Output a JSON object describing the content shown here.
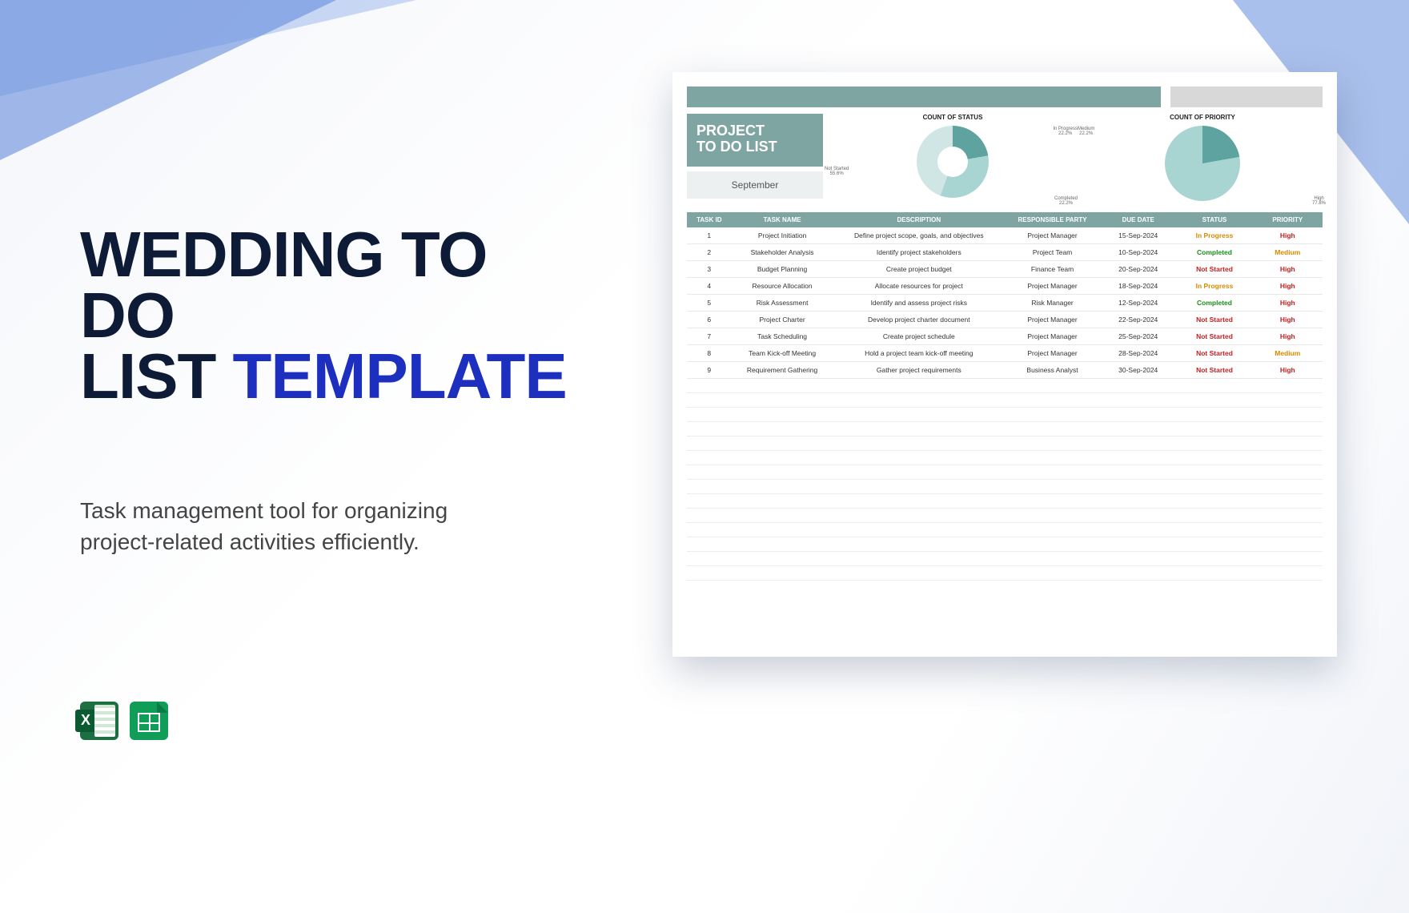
{
  "title": {
    "line1": "WEDDING TO DO",
    "line2a": "LIST ",
    "line2b": "TEMPLATE"
  },
  "subtitle": "Task management tool for organizing project-related activities efficiently.",
  "icons": {
    "excel": "excel-icon",
    "sheets": "google-sheets-icon"
  },
  "preview": {
    "heading_line1": "PROJECT",
    "heading_line2": "TO DO LIST",
    "month": "September",
    "chart1_title": "COUNT OF STATUS",
    "chart2_title": "COUNT OF PRIORITY",
    "labels": {
      "not_started": "Not Started",
      "not_started_pct": "55.6%",
      "in_progress": "In Progress",
      "in_progress_pct": "22.2%",
      "completed": "Completed",
      "completed_pct": "22.2%",
      "medium": "Medium",
      "medium_pct": "22.2%",
      "high": "High",
      "high_pct": "77.8%"
    },
    "columns": {
      "id": "TASK ID",
      "name": "TASK NAME",
      "desc": "DESCRIPTION",
      "party": "RESPONSIBLE PARTY",
      "due": "DUE DATE",
      "status": "STATUS",
      "priority": "PRIORITY"
    },
    "rows": [
      {
        "id": "1",
        "name": "Project Initiation",
        "desc": "Define project scope, goals, and objectives",
        "party": "Project Manager",
        "due": "15-Sep-2024",
        "status": "In Progress",
        "priority": "High"
      },
      {
        "id": "2",
        "name": "Stakeholder Analysis",
        "desc": "Identify project stakeholders",
        "party": "Project Team",
        "due": "10-Sep-2024",
        "status": "Completed",
        "priority": "Medium"
      },
      {
        "id": "3",
        "name": "Budget Planning",
        "desc": "Create project budget",
        "party": "Finance Team",
        "due": "20-Sep-2024",
        "status": "Not Started",
        "priority": "High"
      },
      {
        "id": "4",
        "name": "Resource Allocation",
        "desc": "Allocate resources for project",
        "party": "Project Manager",
        "due": "18-Sep-2024",
        "status": "In Progress",
        "priority": "High"
      },
      {
        "id": "5",
        "name": "Risk Assessment",
        "desc": "Identify and assess project risks",
        "party": "Risk Manager",
        "due": "12-Sep-2024",
        "status": "Completed",
        "priority": "High"
      },
      {
        "id": "6",
        "name": "Project Charter",
        "desc": "Develop project charter document",
        "party": "Project Manager",
        "due": "22-Sep-2024",
        "status": "Not Started",
        "priority": "High"
      },
      {
        "id": "7",
        "name": "Task Scheduling",
        "desc": "Create project schedule",
        "party": "Project Manager",
        "due": "25-Sep-2024",
        "status": "Not Started",
        "priority": "High"
      },
      {
        "id": "8",
        "name": "Team Kick-off Meeting",
        "desc": "Hold a project team kick-off meeting",
        "party": "Project Manager",
        "due": "28-Sep-2024",
        "status": "Not Started",
        "priority": "Medium"
      },
      {
        "id": "9",
        "name": "Requirement Gathering",
        "desc": "Gather project requirements",
        "party": "Business Analyst",
        "due": "30-Sep-2024",
        "status": "Not Started",
        "priority": "High"
      }
    ]
  },
  "chart_data": [
    {
      "type": "pie",
      "title": "COUNT OF STATUS",
      "series": [
        {
          "name": "Not Started",
          "value": 55.6
        },
        {
          "name": "In Progress",
          "value": 22.2
        },
        {
          "name": "Completed",
          "value": 22.2
        }
      ]
    },
    {
      "type": "pie",
      "title": "COUNT OF PRIORITY",
      "series": [
        {
          "name": "Medium",
          "value": 22.2
        },
        {
          "name": "High",
          "value": 77.8
        }
      ]
    }
  ]
}
